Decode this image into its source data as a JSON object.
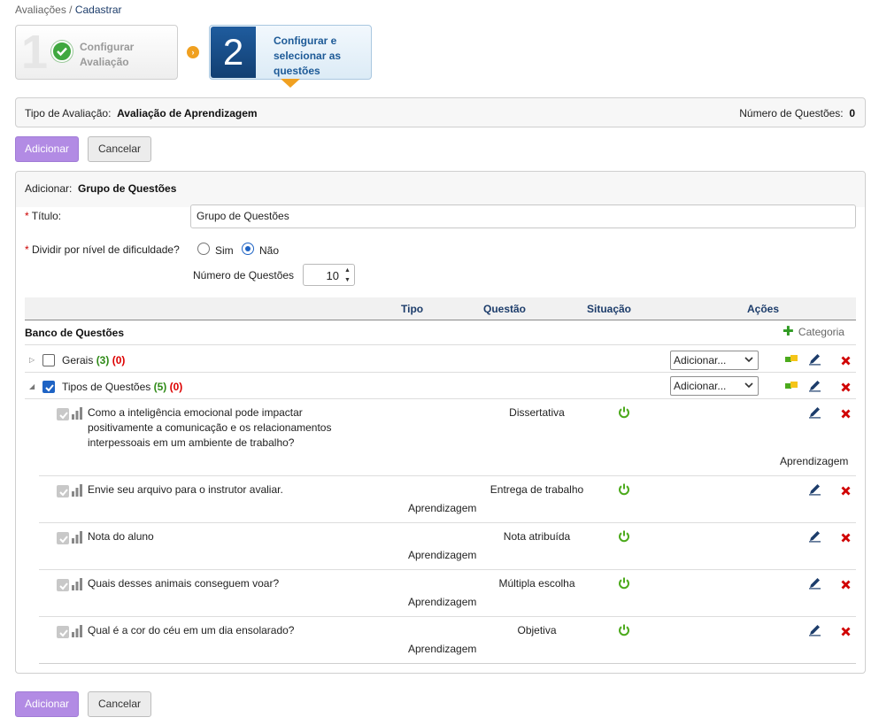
{
  "breadcrumb": {
    "parent": "Avaliações",
    "separator": " / ",
    "current": "Cadastrar"
  },
  "wizard": {
    "step1": {
      "number": "1",
      "label_line1": "Configurar",
      "label_line2": "Avaliação"
    },
    "step2": {
      "number": "2",
      "label_line1": "Configurar e",
      "label_line2": "selecionar as",
      "label_line3": "questões"
    }
  },
  "info": {
    "tipo_label": "Tipo de Avaliação:",
    "tipo_value": "Avaliação de Aprendizagem",
    "num_label": "Número de Questões:",
    "num_value": "0"
  },
  "actions": {
    "add_label": "Adicionar",
    "cancel_label": "Cancelar"
  },
  "panel": {
    "head_label": "Adicionar:",
    "head_value": "Grupo de Questões",
    "title_label": "Título:",
    "title_value": "Grupo de Questões",
    "divide_label": "Dividir por nível de dificuldade?",
    "opt_yes": "Sim",
    "opt_no": "Não",
    "num_questions_label": "Número de Questões",
    "num_questions_value": "10"
  },
  "table": {
    "headers": {
      "tipo": "Tipo",
      "questao": "Questão",
      "situacao": "Situação",
      "acoes": "Ações"
    },
    "bank_label": "Banco de Questões",
    "category_label": "Categoria",
    "groups": [
      {
        "name": "Gerais",
        "green": "(3)",
        "red": "(0)",
        "select": "Adicionar...",
        "expanded": false,
        "checked": false
      },
      {
        "name": "Tipos de Questões",
        "green": "(5)",
        "red": "(0)",
        "select": "Adicionar...",
        "expanded": true,
        "checked": true
      }
    ],
    "questions": [
      {
        "line1": "Como a inteligência emocional pode impactar",
        "line2": "positivamente a comunicação e os relacionamentos",
        "line3": "interpessoais em um ambiente de trabalho?",
        "tipo": "Dissertativa",
        "categoria": "Aprendizagem"
      },
      {
        "line1": "Envie seu arquivo para o instrutor avaliar.",
        "tipo": "Entrega de trabalho",
        "categoria": "Aprendizagem"
      },
      {
        "line1": "Nota do aluno",
        "tipo": "Nota atribuída",
        "categoria": "Aprendizagem"
      },
      {
        "line1": "Quais desses animais conseguem voar?",
        "tipo": "Múltipla escolha",
        "categoria": "Aprendizagem"
      },
      {
        "line1": "Qual é a cor do céu em um dia ensolarado?",
        "tipo": "Objetiva",
        "categoria": "Aprendizagem"
      }
    ]
  },
  "colors": {
    "primary_button": "#b28be4",
    "link_blue": "#1d3d6b",
    "accent_orange": "#f0a020",
    "status_green": "#4caa1c",
    "delete_red": "#d00000"
  }
}
